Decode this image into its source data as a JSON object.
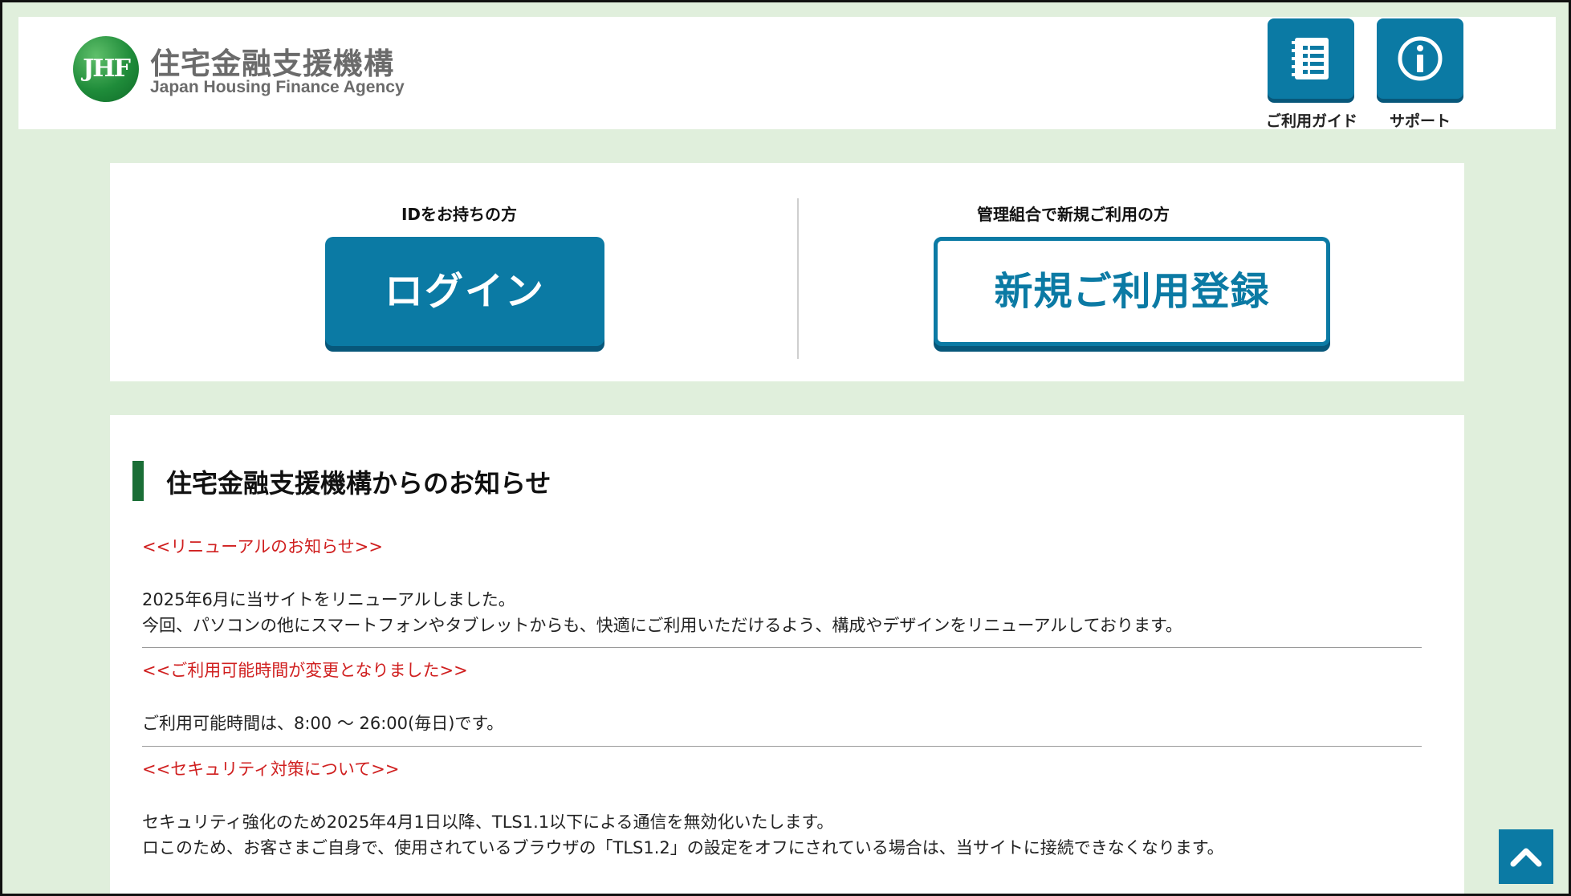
{
  "header": {
    "logo_mark": "JHF",
    "logo_name_jp": "住宅金融支援機構",
    "logo_name_en": "Japan Housing Finance Agency",
    "buttons": [
      {
        "label": "ご利用ガイド",
        "icon": "guide-list-icon"
      },
      {
        "label": "サポート",
        "icon": "info-icon"
      }
    ]
  },
  "login": {
    "existing_title": "IDをお持ちの方",
    "login_label": "ログイン",
    "new_title": "管理組合で新規ご利用の方",
    "register_label": "新規ご利用登録"
  },
  "news": {
    "heading": "住宅金融支援機構からのお知らせ",
    "notices": [
      {
        "title": "<<リニューアルのお知らせ>>",
        "lines": [
          "2025年6月に当サイトをリニューアルしました。",
          "今回、パソコンの他にスマートフォンやタブレットからも、快適にご利用いただけるよう、構成やデザインをリニューアルしております。"
        ]
      },
      {
        "title": "<<ご利用可能時間が変更となりました>>",
        "lines": [
          "ご利用可能時間は、8:00 ～ 26:00(毎日)です。"
        ]
      },
      {
        "title": "<<セキュリティ対策について>>",
        "lines": [
          "セキュリティ強化のため2025年4月1日以降、TLS1.1以下による通信を無効化いたします。",
          "ロこのため、お客さまご自身で、使用されているブラウザの「TLS1.2」の設定をオフにされている場合は、当サイトに接続できなくなります。"
        ]
      }
    ]
  },
  "colors": {
    "primary": "#0b7aa4",
    "background": "#e0efdc",
    "notice_title": "#d02020",
    "heading_bar": "#1a6e36"
  }
}
